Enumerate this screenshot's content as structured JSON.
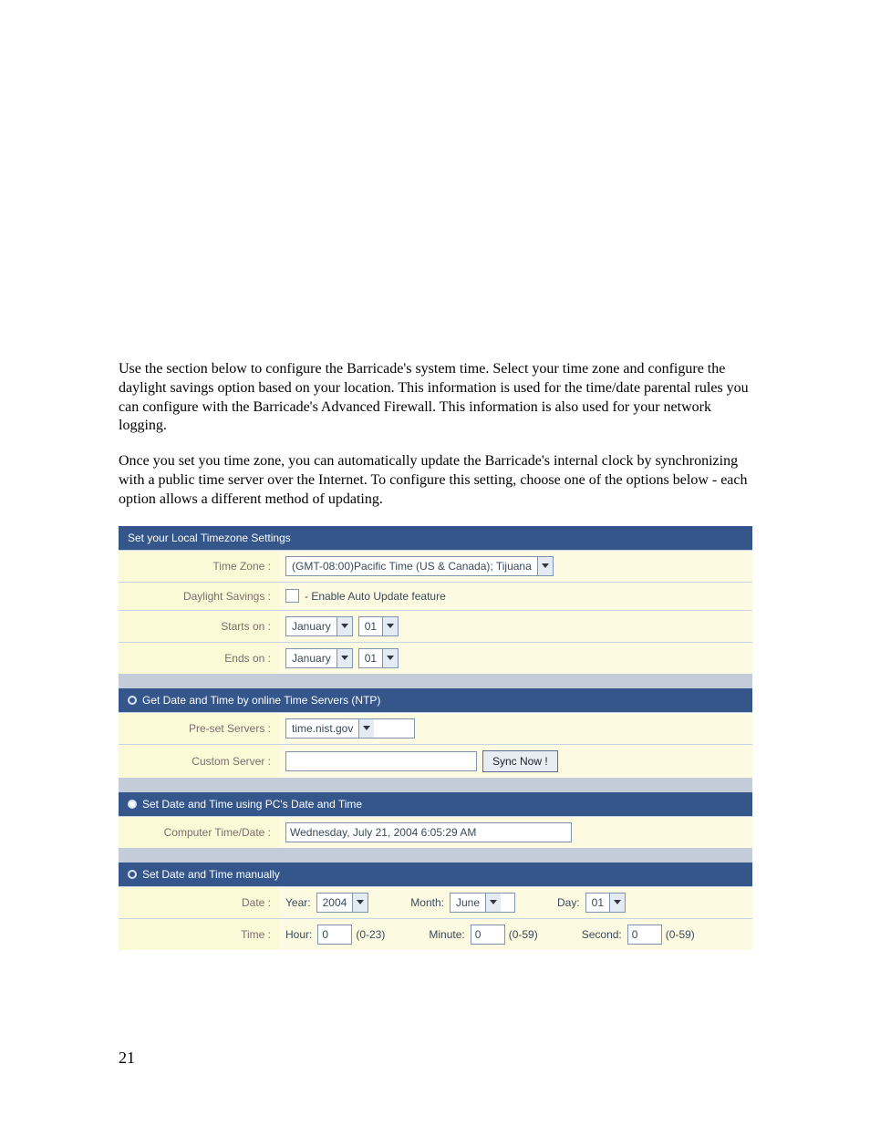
{
  "intro_p1": "Use the section below to configure the Barricade's system time. Select your time zone and configure the daylight savings option based on your location. This information is used for the time/date parental rules you can configure with the Barricade's Advanced Firewall. This information is also used for your network logging.",
  "intro_p2": "Once you set you time zone, you can automatically update the Barricade's internal clock by synchronizing with a public time server over the Internet. To configure this setting, choose one of the options below - each option allows a different method of updating.",
  "page_number": "21",
  "tz": {
    "header": "Set your Local Timezone Settings",
    "timezone_label": "Time Zone :",
    "timezone_value": "(GMT-08:00)Pacific Time (US & Canada); Tijuana",
    "daylight_label": "Daylight Savings :",
    "daylight_cb_text": " - Enable Auto Update feature",
    "starts_label": "Starts on :",
    "starts_month": "January",
    "starts_day": "01",
    "ends_label": "Ends on :",
    "ends_month": "January",
    "ends_day": "01"
  },
  "ntp": {
    "header": "Get Date and Time by online Time Servers (NTP)",
    "preset_label": "Pre-set Servers :",
    "preset_value": "time.nist.gov",
    "custom_label": "Custom Server :",
    "custom_value": "",
    "sync_btn": "Sync Now !"
  },
  "pc": {
    "header": "Set Date and Time using PC's Date and Time",
    "label": "Computer Time/Date :",
    "value": "Wednesday, July 21, 2004 6:05:29 AM"
  },
  "manual": {
    "header": "Set Date and Time manually",
    "date_label": "Date :",
    "year_label": "Year:",
    "year_value": "2004",
    "month_label": "Month:",
    "month_value": "June",
    "day_label": "Day:",
    "day_value": "01",
    "time_label": "Time :",
    "hour_label": "Hour:",
    "hour_value": "0",
    "hour_range": "(0-23)",
    "minute_label": "Minute:",
    "minute_value": "0",
    "minute_range": "(0-59)",
    "second_label": "Second:",
    "second_value": "0",
    "second_range": "(0-59)"
  }
}
